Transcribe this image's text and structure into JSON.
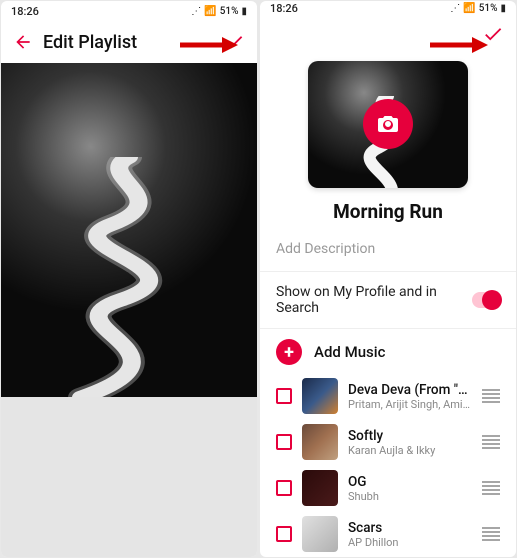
{
  "status": {
    "time": "18:26",
    "battery": "51%"
  },
  "left": {
    "title": "Edit Playlist"
  },
  "right": {
    "playlist_name": "Morning Run",
    "description_placeholder": "Add Description",
    "toggle_label": "Show on My Profile and in Search",
    "add_music_label": "Add Music",
    "songs": [
      {
        "title": "Deva Deva (From \"Brah…",
        "artist": "Pritam, Arijit Singh, Amitabh Bha…"
      },
      {
        "title": "Softly",
        "artist": "Karan Aujla & Ikky"
      },
      {
        "title": "OG",
        "artist": "Shubh"
      },
      {
        "title": "Scars",
        "artist": "AP Dhillon"
      }
    ]
  },
  "colors": {
    "accent": "#e6003c"
  }
}
